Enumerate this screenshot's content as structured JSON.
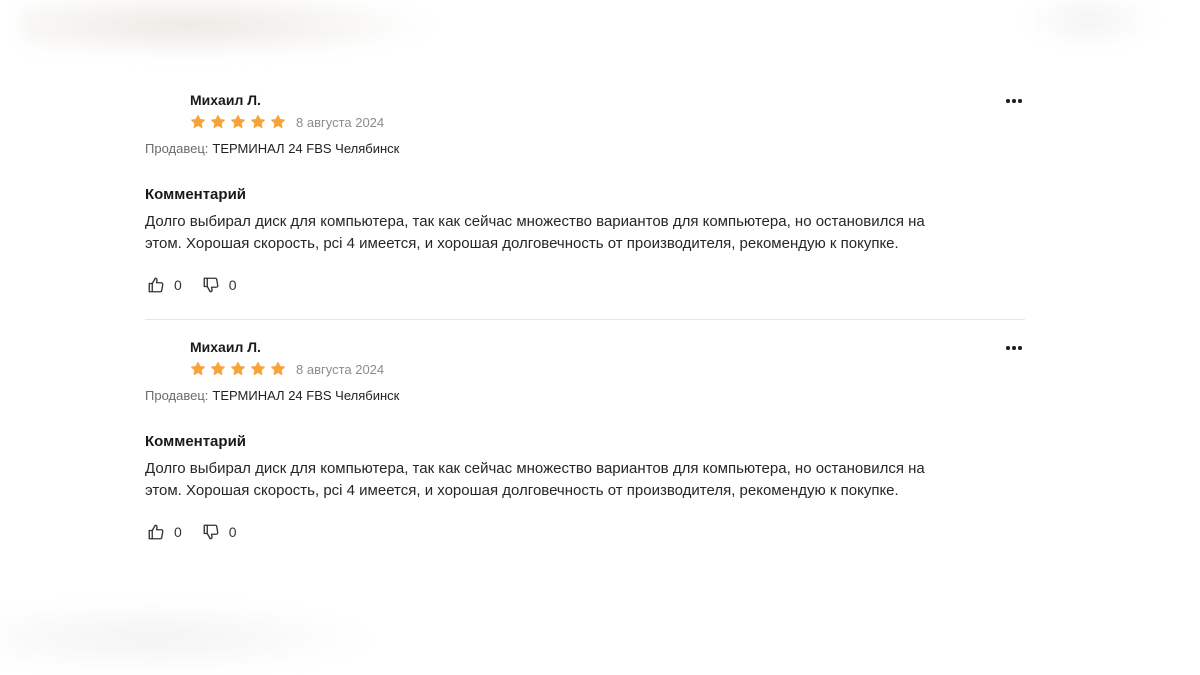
{
  "reviews": [
    {
      "author": "Михаил Л.",
      "rating": 5,
      "rating_max": 5,
      "date": "8 августа 2024",
      "seller_label": "Продавец:",
      "seller_name": "ТЕРМИНАЛ 24 FBS Челябинск",
      "comment_title": "Комментарий",
      "comment_line1": "Долго выбирал диск для компьютера, так как сейчас множество вариантов для компьютера, но остановился на",
      "comment_line2": "этом. Хорошая скорость, pci 4 имеется, и хорошая долговечность от производителя, рекомендую к покупке.",
      "likes": "0",
      "dislikes": "0"
    },
    {
      "author": "Михаил Л.",
      "rating": 5,
      "rating_max": 5,
      "date": "8 августа 2024",
      "seller_label": "Продавец:",
      "seller_name": "ТЕРМИНАЛ 24 FBS Челябинск",
      "comment_title": "Комментарий",
      "comment_line1": "Долго выбирал диск для компьютера, так как сейчас множество вариантов для компьютера, но остановился на",
      "comment_line2": "этом. Хорошая скорость, pci 4 имеется, и хорошая долговечность от производителя, рекомендую к покупке.",
      "likes": "0",
      "dislikes": "0"
    }
  ],
  "colors": {
    "star": "#f7a33a",
    "text": "#1f1f1f",
    "muted": "#8c8c8c",
    "divider": "#e6e6e6"
  },
  "icons": {
    "more": "more-horizontal-icon",
    "like": "thumbs-up-icon",
    "dislike": "thumbs-down-icon",
    "star": "star-icon"
  }
}
